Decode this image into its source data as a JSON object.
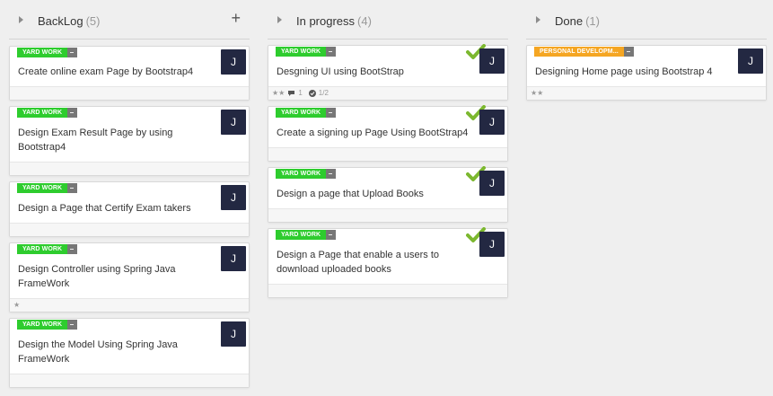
{
  "columns": [
    {
      "title": "BackLog",
      "count": "(5)",
      "add_label": "+",
      "cards": [
        {
          "tag": "YARD WORK",
          "title": "Create online exam Page by Bootstrap4",
          "avatar": "J"
        },
        {
          "tag": "YARD WORK",
          "title": "Design Exam Result Page by using Bootstrap4",
          "avatar": "J"
        },
        {
          "tag": "YARD WORK",
          "title": "Design a Page that Certify Exam takers",
          "avatar": "J"
        },
        {
          "tag": "YARD WORK",
          "title": "Design Controller using Spring Java FrameWork",
          "avatar": "J",
          "rating": "★"
        },
        {
          "tag": "YARD WORK",
          "title": "Design the Model Using Spring Java FrameWork",
          "avatar": "J"
        }
      ]
    },
    {
      "title": "In progress",
      "count": "(4)",
      "cards": [
        {
          "tag": "YARD WORK",
          "title": "Desgning UI using BootStrap",
          "avatar": "J",
          "rating": "★★",
          "comments": "1",
          "checklist": "1/2"
        },
        {
          "tag": "YARD WORK",
          "title": "Create a signing up Page Using BootStrap4",
          "avatar": "J"
        },
        {
          "tag": "YARD WORK",
          "title": "Design a page that Upload Books",
          "avatar": "J"
        },
        {
          "tag": "YARD WORK",
          "title": "Design a Page that enable a users to download uploaded books",
          "avatar": "J"
        }
      ]
    },
    {
      "title": "Done",
      "count": "(1)",
      "cards": [
        {
          "tag": "PERSONAL DEVELOPM...",
          "title": "Designing Home page using Bootstrap 4",
          "avatar": "J",
          "rating": "★★"
        }
      ]
    }
  ],
  "colors": {
    "tag_green": "#2ecc2e",
    "tag_orange": "#f5a623",
    "avatar_bg": "#232842",
    "check_green": "#7cb82f"
  }
}
